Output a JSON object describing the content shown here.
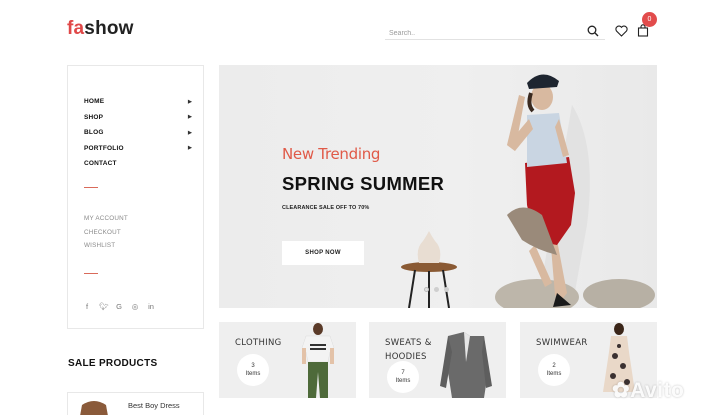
{
  "header": {
    "logo_accent": "fa",
    "logo_rest": "show",
    "search_placeholder": "Search..",
    "cart_count": "0"
  },
  "sidebar": {
    "nav": [
      {
        "label": "HOME",
        "has_arrow": true
      },
      {
        "label": "SHOP",
        "has_arrow": true
      },
      {
        "label": "BLOG",
        "has_arrow": true
      },
      {
        "label": "PORTFOLIO",
        "has_arrow": true
      },
      {
        "label": "CONTACT",
        "has_arrow": false
      }
    ],
    "sub": [
      "MY ACCOUNT",
      "CHECKOUT",
      "WISHLIST"
    ],
    "social": [
      {
        "icon": "facebook-icon",
        "glyph": "f"
      },
      {
        "icon": "twitter-icon",
        "glyph": "y"
      },
      {
        "icon": "google-icon",
        "glyph": "G"
      },
      {
        "icon": "instagram-icon",
        "glyph": "◎"
      },
      {
        "icon": "linkedin-icon",
        "glyph": "in"
      }
    ],
    "accent_color": "#d96a5a"
  },
  "hero": {
    "subtitle": "New Trending",
    "title": "SPRING SUMMER",
    "note": "CLEARANCE SALE OFF TO 70%",
    "button": "SHOP NOW",
    "slides": 3,
    "active_slide": 1,
    "subtitle_color": "#e05a48"
  },
  "categories": [
    {
      "title_line1": "CLOTHING",
      "title_line2": "",
      "count": "3",
      "unit": "Items"
    },
    {
      "title_line1": "SWEATS &",
      "title_line2": "HOODIES",
      "count": "7",
      "unit": "Items"
    },
    {
      "title_line1": "SWIMWEAR",
      "title_line2": "",
      "count": "2",
      "unit": "Items"
    }
  ],
  "sale": {
    "title": "SALE PRODUCTS",
    "first_product": "Best Boy Dress"
  },
  "watermark": "Avito"
}
